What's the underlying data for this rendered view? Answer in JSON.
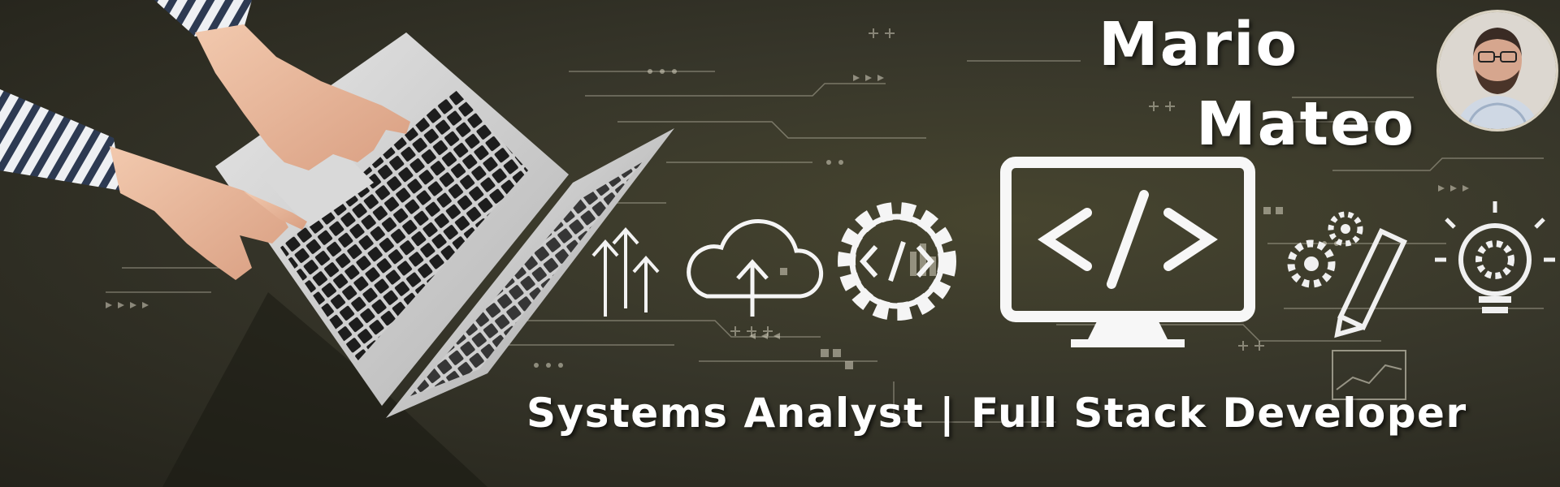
{
  "profile": {
    "first_name": "Mario",
    "last_name": "Mateo",
    "tagline": "Systems Analyst | Full Stack Developer"
  },
  "icons": [
    "cloud-upload-icon",
    "gear-code-icon",
    "monitor-code-icon",
    "gears-pencil-icon",
    "lightbulb-gear-icon",
    "arrows-up-icon"
  ],
  "colors": {
    "background": "#37362a",
    "foreground": "#ffffff"
  }
}
